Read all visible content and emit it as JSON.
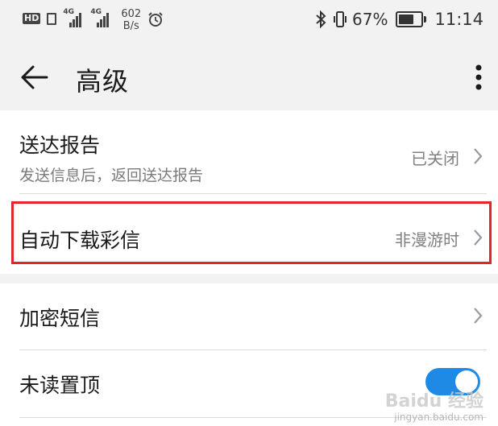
{
  "status_bar": {
    "hd_badge": "HD",
    "network_1": "4G",
    "network_2": "4G",
    "speed_value": "602",
    "speed_unit": "B/s",
    "battery_percent": "67%",
    "battery_level": 0.67,
    "time": "11:14"
  },
  "header": {
    "title": "高级"
  },
  "settings": {
    "delivery_report": {
      "title": "送达报告",
      "subtitle": "发送信息后，返回送达报告",
      "value": "已关闭"
    },
    "auto_download_mms": {
      "title": "自动下载彩信",
      "value": "非漫游时"
    },
    "encrypted_sms": {
      "title": "加密短信"
    },
    "pin_unread": {
      "title": "未读置顶",
      "enabled": true
    }
  },
  "colors": {
    "accent": "#1e8ae6",
    "highlight_border": "#e0262c",
    "background_gray": "#f2f2f2"
  },
  "watermark": {
    "main": "Baidu 经验",
    "sub": "jingyan.baidu.com"
  }
}
